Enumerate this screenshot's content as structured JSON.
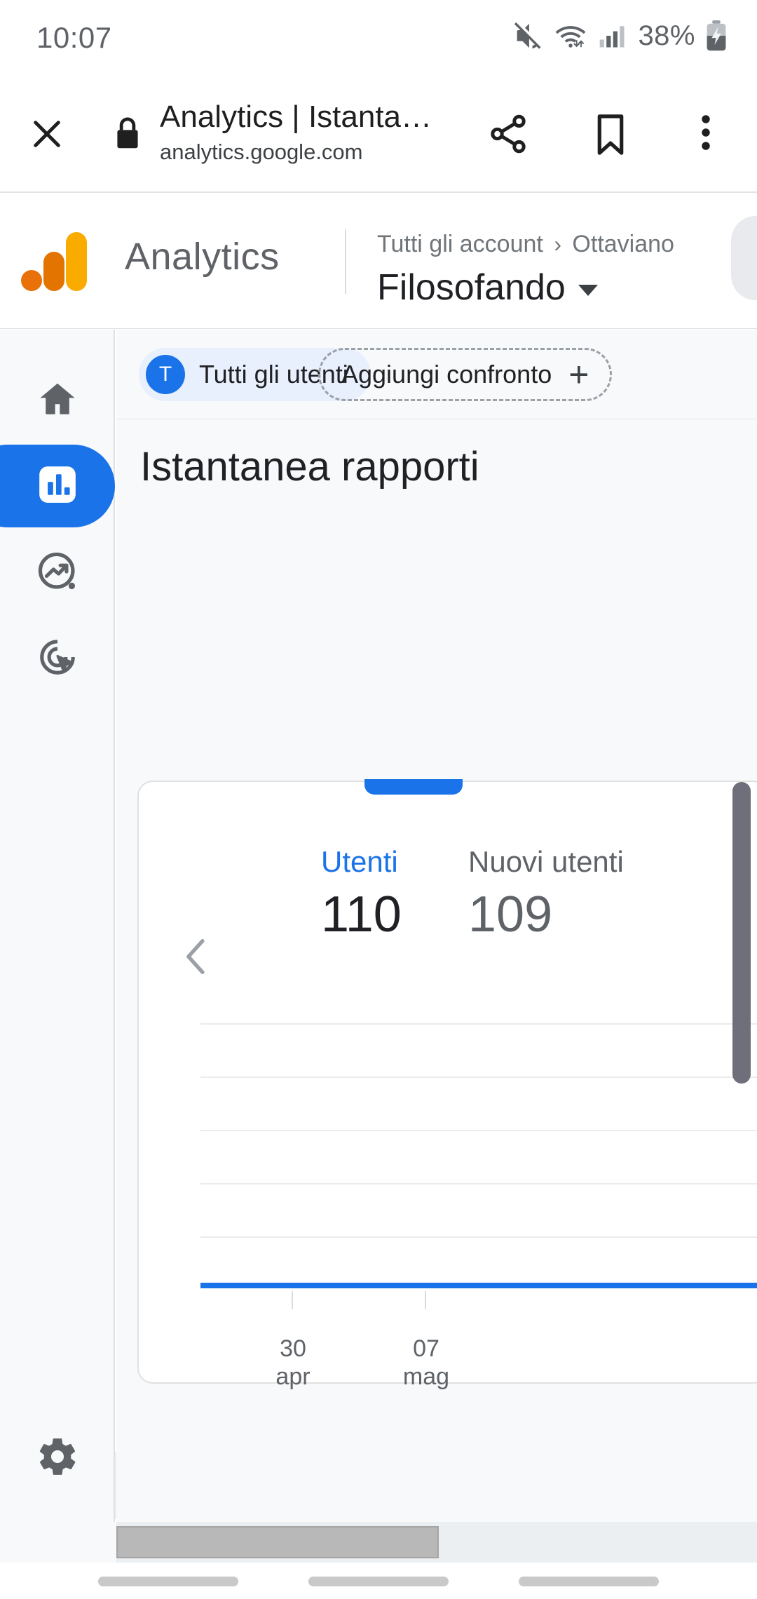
{
  "status_bar": {
    "time": "10:07",
    "battery_percent": "38%",
    "icons": [
      "mute-icon",
      "wifi-icon",
      "signal-icon",
      "battery-charging-icon"
    ]
  },
  "browser": {
    "close_label": "close-icon",
    "security_icon": "lock-icon",
    "page_title": "Analytics | Istanta…",
    "page_url": "analytics.google.com",
    "share_icon": "share-icon",
    "bookmark_icon": "bookmark-icon",
    "menu_icon": "more-vertical-icon"
  },
  "ga_header": {
    "wordmark": "Analytics",
    "breadcrumb_root": "Tutti gli account",
    "breadcrumb_separator": "›",
    "breadcrumb_account": "Ottaviano",
    "property_name": "Filosofando",
    "logo_colors": {
      "dot": "#e8710a",
      "mid_bar": "#e37400",
      "tall_bar": "#f9ab00"
    }
  },
  "sidebar": {
    "items": [
      {
        "name": "home",
        "icon": "home-icon",
        "active": false
      },
      {
        "name": "reports",
        "icon": "bar-chart-icon",
        "active": true
      },
      {
        "name": "explore",
        "icon": "explore-trend-icon",
        "active": false
      },
      {
        "name": "advertising",
        "icon": "target-cursor-icon",
        "active": false
      }
    ],
    "admin": {
      "name": "admin",
      "icon": "gear-icon"
    },
    "expand_icon": "chevron-right-icon",
    "active_color": "#1a73e8"
  },
  "main": {
    "audience_chip": {
      "avatar_letter": "T",
      "label": "Tutti gli utenti"
    },
    "add_comparison_chip": {
      "label": "Aggiungi confronto",
      "plus": "+"
    },
    "report_title": "Istantanea rapporti",
    "prev_arrow_icon": "chevron-left-icon"
  },
  "chart_data": {
    "type": "line",
    "title": "Istantanea rapporti",
    "metrics": [
      {
        "label": "Utenti",
        "value": "110",
        "selected": true,
        "color": "#1a73e8"
      },
      {
        "label": "Nuovi utenti",
        "value": "109",
        "selected": false,
        "color": "#5f6368"
      }
    ],
    "x": [
      "30 apr",
      "07 mag"
    ],
    "tick_labels": [
      {
        "day": "30",
        "month": "apr"
      },
      {
        "day": "07",
        "month": "mag"
      }
    ],
    "series": [
      {
        "name": "Utenti",
        "values": [
          0,
          0
        ],
        "color": "#1a73e8"
      }
    ],
    "xlabel": "",
    "ylabel": "",
    "ylim": [
      0,
      6
    ],
    "gridlines": 6,
    "grid": true,
    "legend": "none"
  }
}
